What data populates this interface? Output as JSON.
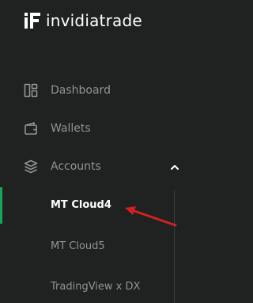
{
  "brand": {
    "name": "invidiatrade"
  },
  "nav": {
    "dashboard": {
      "label": "Dashboard",
      "icon": "dashboard-icon"
    },
    "wallets": {
      "label": "Wallets",
      "icon": "wallet-icon"
    },
    "accounts": {
      "label": "Accounts",
      "icon": "layers-icon",
      "expanded": true
    }
  },
  "accounts_submenu": [
    {
      "label": "MT Cloud4",
      "active": true
    },
    {
      "label": "MT Cloud5",
      "active": false
    },
    {
      "label": "TradingView x DX",
      "active": false
    }
  ],
  "colors": {
    "background": "#1f2220",
    "active_accent": "#1aa35a",
    "annotation_arrow": "#d32020"
  }
}
